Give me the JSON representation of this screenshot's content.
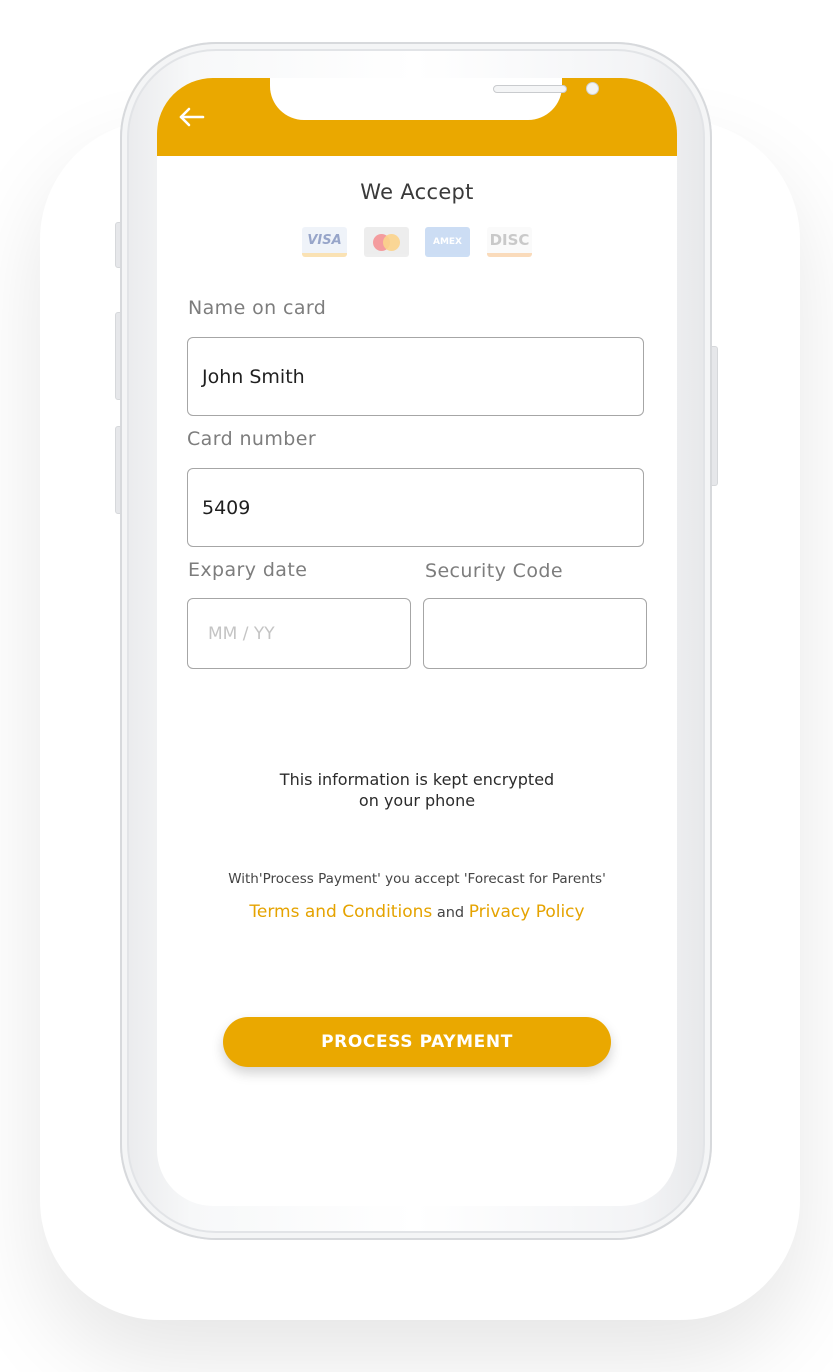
{
  "colors": {
    "accent": "#eaa800",
    "link": "#e5a300"
  },
  "header": {
    "back_icon": "arrow-left-icon"
  },
  "accepted": {
    "title": "We Accept",
    "cards": [
      {
        "label": "VISA",
        "icon": "visa-icon"
      },
      {
        "label": "",
        "icon": "mastercard-icon"
      },
      {
        "label": "AMEX",
        "icon": "amex-icon"
      },
      {
        "label": "DISC",
        "icon": "discover-icon"
      }
    ]
  },
  "form": {
    "name": {
      "label": "Name on card",
      "value": "John Smith"
    },
    "card_number": {
      "label": "Card number",
      "value": "5409"
    },
    "expiry": {
      "label": "Expary date",
      "placeholder": "MM / YY",
      "value": ""
    },
    "security": {
      "label": "Security Code",
      "value": ""
    }
  },
  "encryption_note": {
    "line1": "This information is kept encrypted",
    "line2": "on your phone"
  },
  "terms": {
    "text": "With'Process Payment' you accept 'Forecast for Parents'",
    "terms_link": "Terms and Conditions",
    "and": "and",
    "privacy_link": "Privacy Policy"
  },
  "actions": {
    "process_payment": "PROCESS PAYMENT"
  }
}
